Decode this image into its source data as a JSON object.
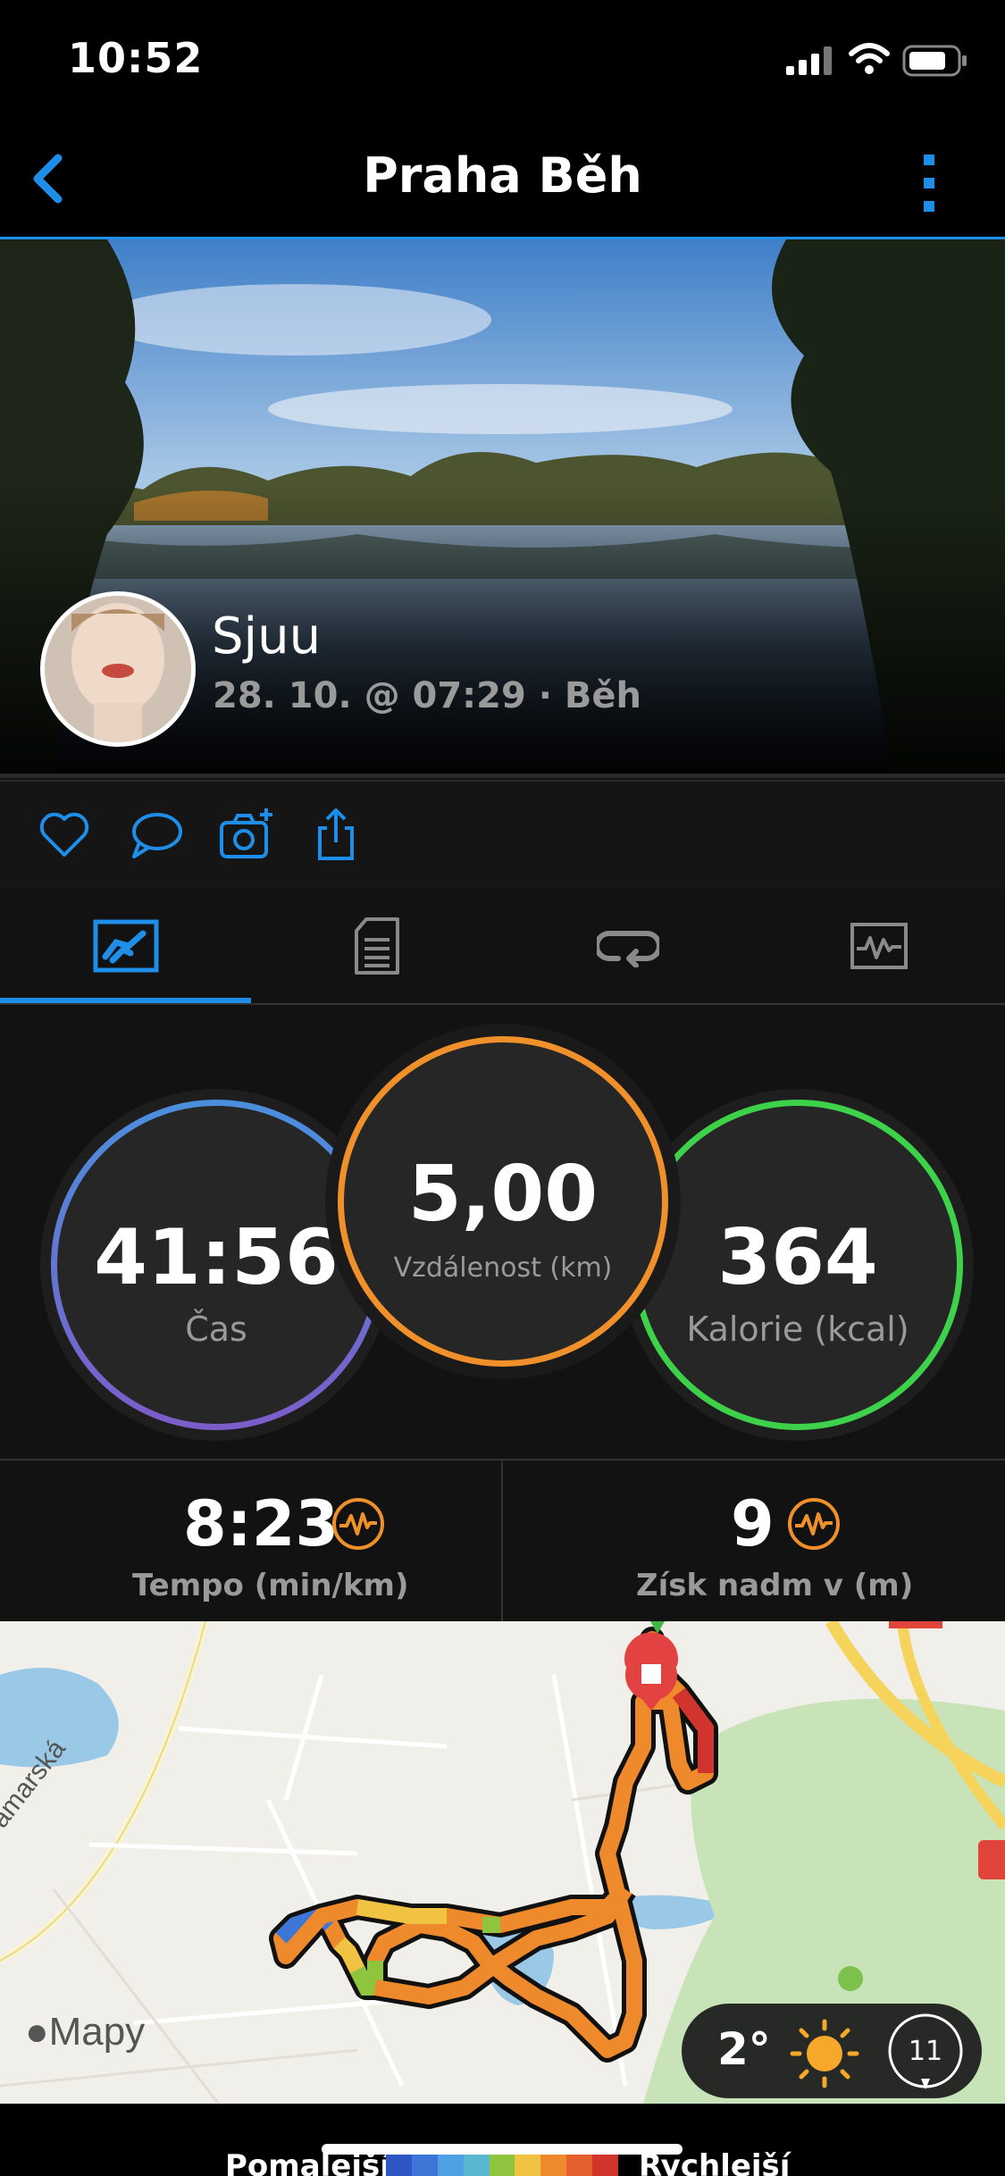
{
  "status_bar": {
    "time": "10:52"
  },
  "nav": {
    "title": "Praha Běh"
  },
  "activity": {
    "user_name": "Sjuu",
    "meta": "28. 10. @ 07:29 · Běh"
  },
  "stats": {
    "time": {
      "value": "41:56",
      "label": "Čas"
    },
    "distance": {
      "value": "5,00",
      "label": "Vzdálenost (km)"
    },
    "calories": {
      "value": "364",
      "label": "Kalorie (kcal)"
    },
    "pace": {
      "value": "8:23",
      "label": "Tempo (min/km)"
    },
    "elevation": {
      "value": "9",
      "label": "Získ nadm v (m)"
    }
  },
  "map": {
    "street_label": "amarská",
    "brand": "Mapy",
    "weather_temp": "2°",
    "wind_speed": "11"
  },
  "legend": {
    "slower": "Pomalejší",
    "faster": "Rychlejší"
  },
  "colors": {
    "accent": "#1f8ee8",
    "time_ring": "#4a8fdd",
    "distance_ring": "#f0902a",
    "calories_ring": "#3ed14a"
  }
}
